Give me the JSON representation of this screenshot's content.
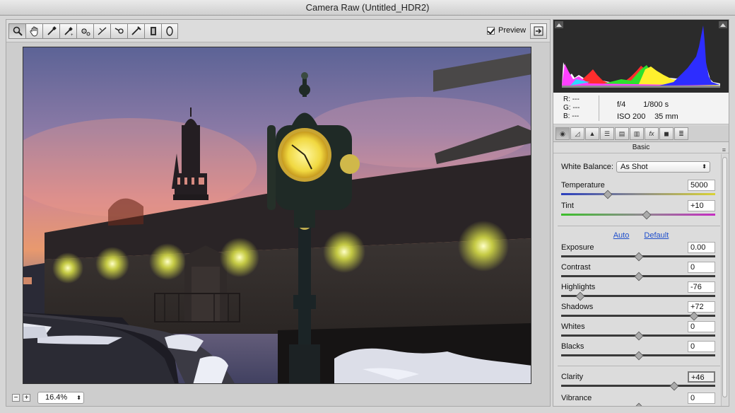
{
  "window": {
    "title": "Camera Raw (Untitled_HDR2)"
  },
  "toolbar": {
    "tools": [
      "zoom-tool",
      "hand-tool",
      "white-balance-tool",
      "color-sampler-tool",
      "target-adjustment-tool",
      "straighten-tool",
      "spot-removal-tool",
      "red-eye-tool",
      "adjustment-brush",
      "graduated-filter",
      "radial-filter"
    ],
    "preview_label": "Preview",
    "preview_checked": true
  },
  "status": {
    "zoom": "16.4%"
  },
  "readout": {
    "r_label": "R:",
    "g_label": "G:",
    "b_label": "B:",
    "r": "---",
    "g": "---",
    "b": "---",
    "aperture": "f/4",
    "shutter": "1/800 s",
    "iso": "ISO 200",
    "focal_length": "35 mm"
  },
  "panel": {
    "tabs": [
      "basic",
      "tone-curve",
      "detail",
      "hsl",
      "split-toning",
      "lens",
      "effects",
      "camera-calibration",
      "presets"
    ],
    "title": "Basic"
  },
  "basic": {
    "white_balance_label": "White Balance:",
    "white_balance_value": "As Shot",
    "temperature": {
      "label": "Temperature",
      "value": "5000",
      "pos": 0.3
    },
    "tint": {
      "label": "Tint",
      "value": "+10",
      "pos": 0.55
    },
    "auto_label": "Auto",
    "default_label": "Default",
    "exposure": {
      "label": "Exposure",
      "value": "0.00",
      "pos": 0.5
    },
    "contrast": {
      "label": "Contrast",
      "value": "0",
      "pos": 0.5
    },
    "highlights": {
      "label": "Highlights",
      "value": "-76",
      "pos": 0.12
    },
    "shadows": {
      "label": "Shadows",
      "value": "+72",
      "pos": 0.86
    },
    "whites": {
      "label": "Whites",
      "value": "0",
      "pos": 0.5
    },
    "blacks": {
      "label": "Blacks",
      "value": "0",
      "pos": 0.5
    },
    "clarity": {
      "label": "Clarity",
      "value": "+46",
      "pos": 0.73
    },
    "vibrance": {
      "label": "Vibrance",
      "value": "0",
      "pos": 0.5
    }
  },
  "colors": {
    "accent_link": "#1f4fcc"
  }
}
